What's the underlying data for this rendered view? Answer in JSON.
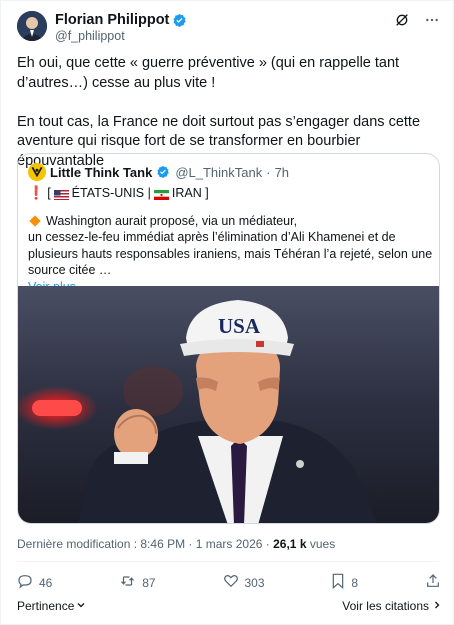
{
  "author": {
    "name": "Florian Philippot",
    "handle": "@f_philippot"
  },
  "tweet": {
    "paragraph1": "Eh oui, que cette « guerre préventive » (qui en rappelle tant d’autres…) cesse au plus vite !",
    "paragraph2": "En tout cas, la France ne doit surtout pas s’engager dans cette aventure qui risque fort de se transformer en bourbier épouvantable"
  },
  "quote": {
    "name": "Little Think Tank",
    "handle": "@L_ThinkTank",
    "separator": "·",
    "time": "7h",
    "tag_open": "[",
    "tag_country1": "ÉTATS-UNIS |",
    "tag_country2": "IRAN ]",
    "lead_line1": "Washington aurait proposé, via un médiateur,",
    "lead_line2": "un cessez-le-feu immédiat après l’élimination d’Ali Khamenei et de plusieurs hauts responsables iraniens, mais Téhéran l’a rejeté, selon une source citée …",
    "see_more": "Voir plus",
    "image_caption": "USA"
  },
  "meta": {
    "modified_label": "Dernière modification : 8:46 PM · 1 mars 2026 ·",
    "views_count": "26,1 k",
    "views_label": "vues"
  },
  "actions": {
    "replies": "46",
    "reposts": "87",
    "likes": "303",
    "bookmarks": "8"
  },
  "footer": {
    "relevance": "Pertinence",
    "quotes_link": "Voir les citations"
  },
  "colors": {
    "accent": "#1d9bf0",
    "secondary_text": "#536471",
    "border": "#cfd9de"
  }
}
